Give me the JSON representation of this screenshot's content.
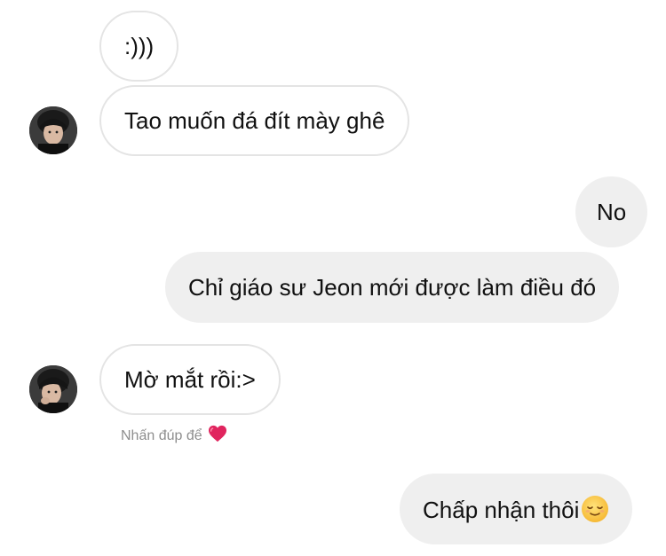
{
  "messages": [
    {
      "id": "m1",
      "direction": "incoming",
      "text": ":)))"
    },
    {
      "id": "m2",
      "direction": "incoming",
      "text": "Tao muốn đá đít mày ghê"
    },
    {
      "id": "m3",
      "direction": "outgoing",
      "text": "No"
    },
    {
      "id": "m4",
      "direction": "outgoing",
      "text": "Chỉ giáo sư Jeon mới được làm điều đó"
    },
    {
      "id": "m5",
      "direction": "incoming",
      "text": "Mờ mắt rồi:>"
    },
    {
      "id": "m6",
      "direction": "outgoing",
      "text": "Chấp nhận thôi",
      "emoji": "relieved-face-icon"
    }
  ],
  "hint": {
    "text": "Nhấn đúp để",
    "icon": "heart-icon"
  },
  "colors": {
    "incoming_border": "#e4e4e4",
    "outgoing_bg": "#efefef",
    "hint_text": "#8e8e8e",
    "heart": "#e0245e"
  }
}
